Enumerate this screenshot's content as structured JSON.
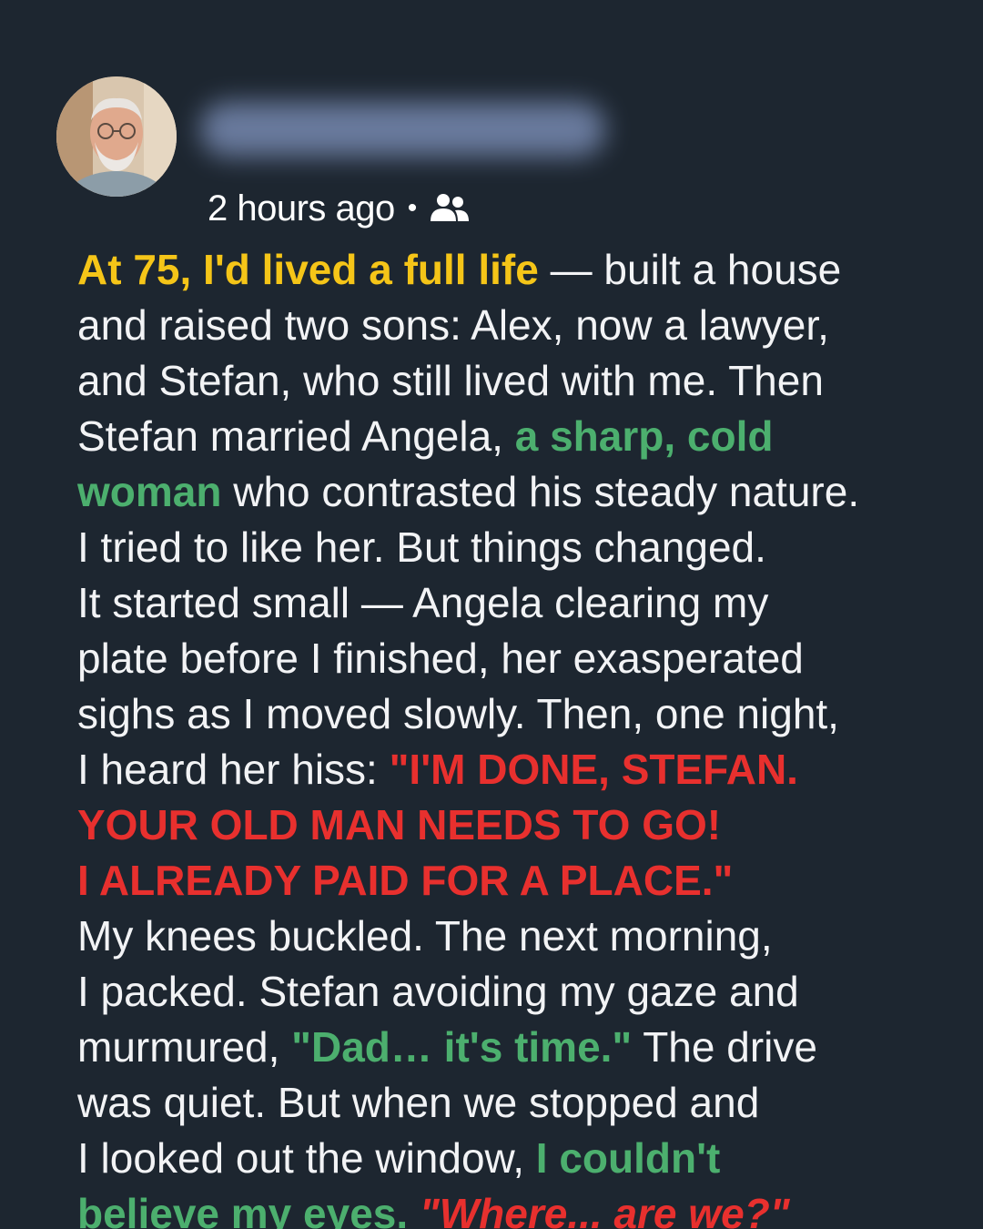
{
  "post": {
    "author_name": "",
    "timestamp": "2 hours ago",
    "separator": "•",
    "audience_icon": "friends-icon"
  },
  "story": {
    "l1": {
      "a": "At 75, I'd lived a full life",
      "b": " — built a house"
    },
    "l2": "and raised two sons: Alex, now a lawyer,",
    "l3": "and Stefan, who still lived with me. Then",
    "l4": {
      "a": "Stefan married Angela, ",
      "b": "a sharp, cold"
    },
    "l5": {
      "a": "woman",
      "b": " who contrasted his steady nature."
    },
    "l6": "I tried to like her. But things changed.",
    "l7": "It started small — Angela clearing my",
    "l8": "plate before I finished, her exasperated",
    "l9": "sighs as I moved slowly. Then, one night,",
    "l10": {
      "a": "I heard her hiss: ",
      "b": "\"I'M DONE, STEFAN."
    },
    "l11": "YOUR OLD MAN NEEDS TO GO!",
    "l12": "I ALREADY PAID FOR A PLACE.\"",
    "l13": "My knees buckled. The next morning,",
    "l14": "I packed. Stefan avoiding my gaze and",
    "l15": {
      "a": "murmured, ",
      "b": "\"Dad… it's time.\"",
      "c": " The drive"
    },
    "l16": "was quiet. But when we stopped and",
    "l17": {
      "a": "I looked out the window, ",
      "b": "I couldn't"
    },
    "l18": {
      "a": "believe my eyes.",
      "b": " \"Where... are we?\""
    }
  },
  "colors": {
    "background": "#1d2630",
    "text": "#f2f3f5",
    "highlight_yellow": "#f5c518",
    "highlight_green": "#4caf6e",
    "highlight_red": "#e8302e"
  }
}
